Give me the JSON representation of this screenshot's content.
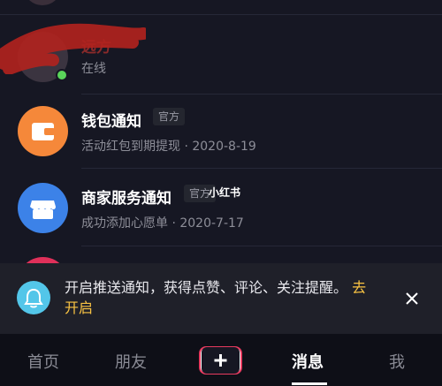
{
  "contacts": [
    {
      "name": "远方",
      "status": "在线"
    }
  ],
  "notifications": [
    {
      "title": "钱包通知",
      "badge": "官方",
      "subtitle": "活动红包到期提现 · 2020-8-19",
      "icon": "wallet-icon",
      "color": "#f5883a"
    },
    {
      "title": "商家服务通知",
      "badge": "官方",
      "subtitle": "成功添加心愿单 · 2020-7-17",
      "icon": "store-icon",
      "color": "#3c82e8"
    }
  ],
  "watermark": "小红书",
  "push_prompt": {
    "text": "开启推送通知，获得点赞、评论、关注提醒。",
    "link": "去开启",
    "icon": "bell-icon",
    "close_icon": "close-icon"
  },
  "tabbar": {
    "tabs": [
      {
        "label": "首页"
      },
      {
        "label": "朋友"
      },
      {
        "label": "消息",
        "active": true
      },
      {
        "label": "我"
      }
    ],
    "plus_icon": "plus-icon"
  },
  "colors": {
    "background": "#161723",
    "accent_yellow": "#f9c343",
    "online_green": "#5ad55a"
  }
}
